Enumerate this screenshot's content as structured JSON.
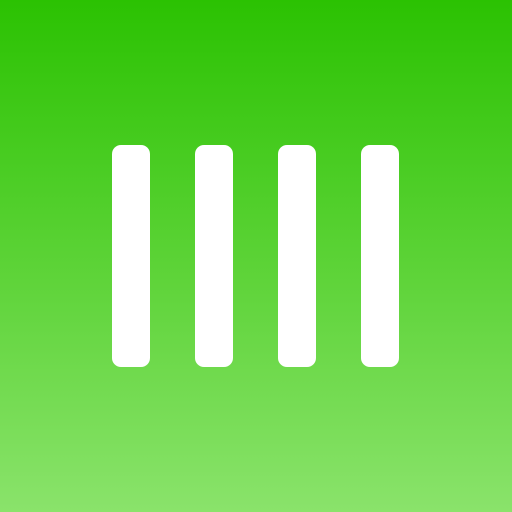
{
  "app_icon": {
    "icon_name": "four-vertical-bars-icon",
    "colors": {
      "gradient_top": "#2bc202",
      "gradient_middle": "#5fd43a",
      "gradient_bottom": "#8ae36b",
      "bar": "#ffffff"
    },
    "bar_count": 4
  }
}
